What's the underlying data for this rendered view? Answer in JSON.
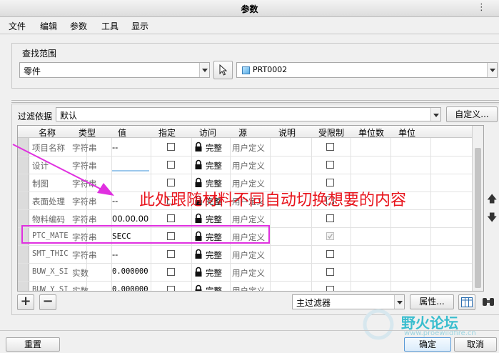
{
  "window": {
    "title": "参数",
    "more_glyph": "⋮"
  },
  "menu": [
    "文件",
    "编辑",
    "参数",
    "工具",
    "显示"
  ],
  "scope": {
    "label": "查找范围",
    "type_value": "零件",
    "model_value": "PRT0002"
  },
  "filter": {
    "label": "过滤依据",
    "value": "默认",
    "customize_label": "自定义..."
  },
  "table": {
    "columns": [
      "名称",
      "类型",
      "值",
      "指定",
      "访问",
      "源",
      "说明",
      "受限制",
      "单位数",
      "单位"
    ],
    "rows": [
      {
        "name": "项目名称",
        "type": "字符串",
        "value": "--",
        "access": "完整",
        "source": "用户定义",
        "restricted_checked": false
      },
      {
        "name": "设计",
        "type": "字符串",
        "value": "",
        "access": "完整",
        "source": "用户定义",
        "restricted_checked": false
      },
      {
        "name": "制图",
        "type": "字符串",
        "value": "",
        "access": "完整",
        "source": "用户定义",
        "restricted_checked": false
      },
      {
        "name": "表面处理",
        "type": "字符串",
        "value": "--",
        "access": "完整",
        "source": "用户定义",
        "restricted_checked": false
      },
      {
        "name": "物料编码",
        "type": "字符串",
        "value": "00.00.00",
        "access": "完整",
        "source": "用户定义",
        "restricted_checked": false
      },
      {
        "name": "PTC_MATE",
        "type": "字符串",
        "value": "SECC",
        "access": "完整",
        "source": "用户定义",
        "restricted_checked": true
      },
      {
        "name": "SMT_THIC",
        "type": "字符串",
        "value": "--",
        "access": "完整",
        "source": "用户定义",
        "restricted_checked": false
      },
      {
        "name": "BUW_X_SI",
        "type": "实数",
        "value": "0.000000",
        "access": "完整",
        "source": "用户定义",
        "restricted_checked": false
      },
      {
        "name": "BUW_Y_SI",
        "type": "实数",
        "value": "0.000000",
        "access": "完整",
        "source": "用户定义",
        "restricted_checked": false
      }
    ]
  },
  "annotation": "此处跟随材料不同自动切换想要的内容",
  "bottom": {
    "add_label": "+",
    "remove_label": "−",
    "main_filter": "主过滤器",
    "properties_label": "属性...",
    "reset_label": "重置",
    "ok_label": "确定",
    "cancel_label": "取消"
  },
  "watermark": {
    "text": "野火论坛",
    "url": "www.proewildfire.cn"
  },
  "colors": {
    "annotation": "#e8141c",
    "highlight": "#e030e0",
    "arrow": "#e030e0"
  }
}
